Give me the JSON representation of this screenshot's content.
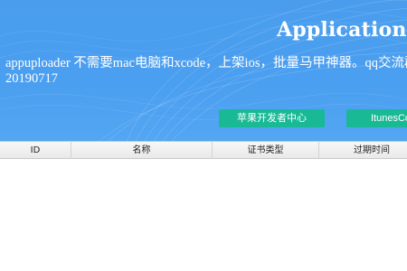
{
  "header": {
    "title": "Application Upl",
    "description_lines": [
      "appuploader 不需要mac电脑和xcode，上架ios，批量马甲神器。qq交流群",
      "20190717"
    ],
    "colors": {
      "banner": "#4b9ff0",
      "button": "#1ab995"
    }
  },
  "buttons": {
    "apple_dev_center": "苹果开发者中心",
    "itunes_connect": "ItunesCon"
  },
  "table": {
    "columns": [
      "ID",
      "名称",
      "证书类型",
      "过期时间"
    ],
    "rows": []
  }
}
